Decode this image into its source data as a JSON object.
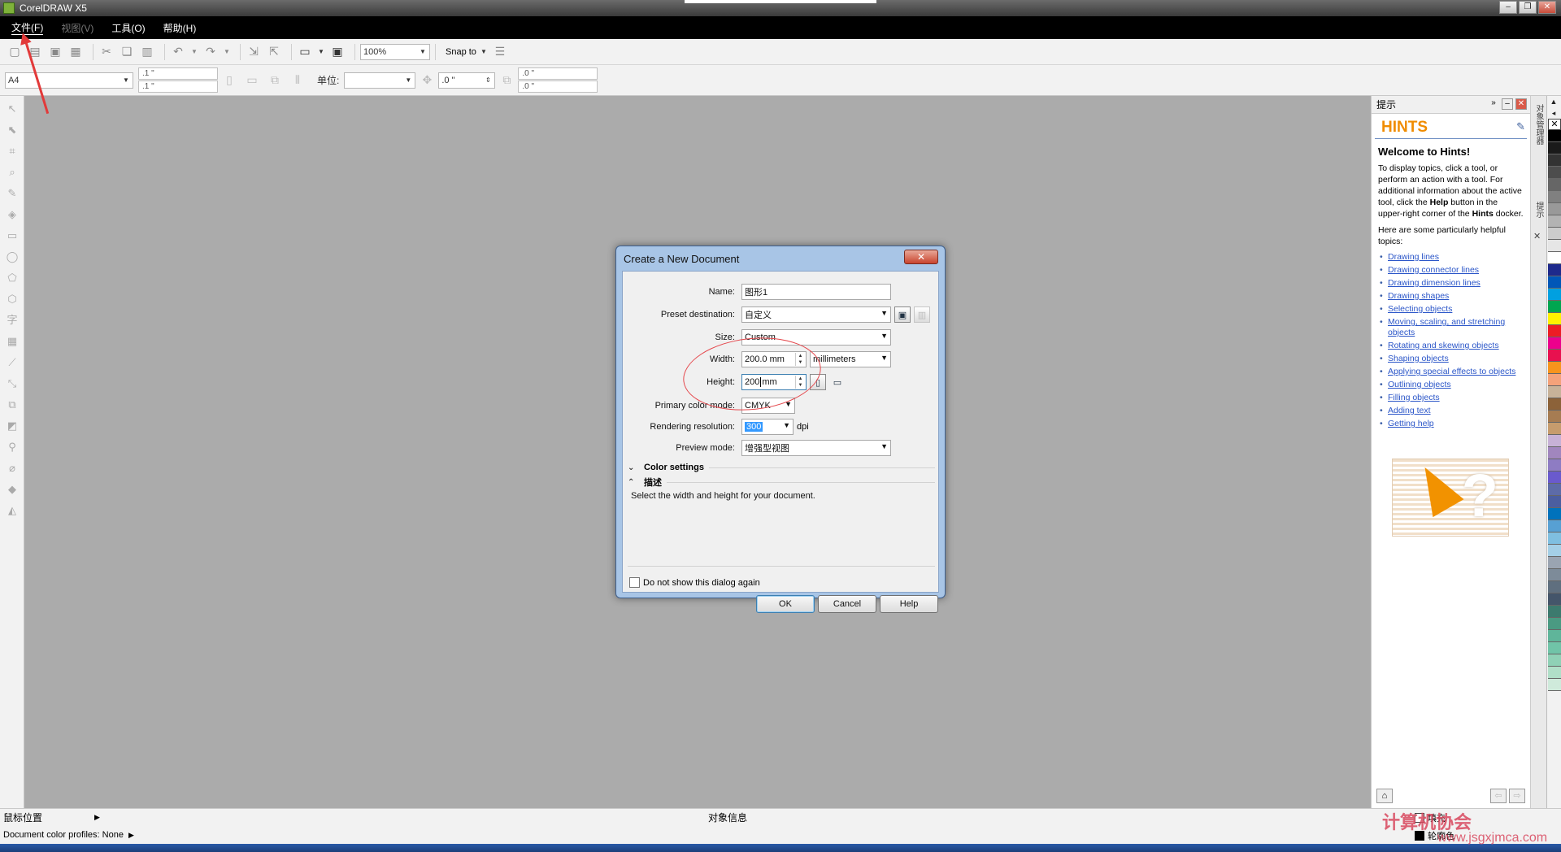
{
  "window": {
    "title": "CorelDRAW X5"
  },
  "menu": [
    {
      "label": "文件(F)",
      "state": "active"
    },
    {
      "label": "视图(V)",
      "state": "disabled"
    },
    {
      "label": "工具(O)",
      "state": "normal"
    },
    {
      "label": "帮助(H)",
      "state": "normal"
    }
  ],
  "toolbar": {
    "zoom": "100%",
    "snap_to": "Snap to"
  },
  "property_bar": {
    "page_size": "A4",
    "width_value": ".1 \"",
    "height_value": ".1 \"",
    "unit_label": "单位:",
    "nudge_value": ".0 \"",
    "dup_x": ".0 \"",
    "dup_y": ".0 \""
  },
  "dialog": {
    "title": "Create a New Document",
    "labels": {
      "name": "Name:",
      "preset": "Preset destination:",
      "size": "Size:",
      "width": "Width:",
      "height": "Height:",
      "color_mode": "Primary color mode:",
      "resolution": "Rendering resolution:",
      "preview": "Preview mode:"
    },
    "values": {
      "name": "图形1",
      "preset": "自定义",
      "size": "Custom",
      "width": "200.0 mm",
      "units": "millimeters",
      "height": "200",
      "height_unit": "mm",
      "color_mode": "CMYK",
      "resolution": "300",
      "resolution_unit": "dpi",
      "preview": "增强型视图"
    },
    "color_settings": "Color settings",
    "description_heading": "描述",
    "description_text": "Select the width and height for your document.",
    "dont_show": "Do not show this dialog again",
    "buttons": {
      "ok": "OK",
      "cancel": "Cancel",
      "help": "Help"
    }
  },
  "hints": {
    "docker_title": "提示",
    "title": "HINTS",
    "welcome": "Welcome to Hints!",
    "para1_a": "To display topics, click a tool, or perform an action with a tool. For additional information about the active tool, click the ",
    "para1_help": "Help",
    "para1_b": " button in the upper-right corner of the ",
    "para1_hints": "Hints",
    "para1_c": " docker.",
    "para2": "Here are some particularly helpful topics:",
    "links": [
      "Drawing lines",
      "Drawing connector lines",
      "Drawing dimension lines",
      "Drawing shapes",
      "Selecting objects",
      "Moving, scaling, and stretching objects",
      "Rotating and skewing objects",
      "Shaping objects",
      "Applying special effects to objects",
      "Outlining objects",
      "Filling objects",
      "Adding text",
      "Getting help"
    ]
  },
  "docker_tabs": [
    "对象管理器",
    "提示"
  ],
  "status": {
    "cursor_position": "鼠标位置",
    "object_info": "对象信息",
    "color_profiles": "Document color profiles: None",
    "fill": "填充",
    "outline": "轮廓色"
  },
  "watermark": {
    "main": "计算机协会",
    "url": "www.jsgxjmca.com"
  },
  "colors": {
    "accent_orange": "#f08c00",
    "link_blue": "#2a55c8",
    "annotation_red": "#e23a3a",
    "palette": [
      "#000000",
      "#1a1a1a",
      "#333333",
      "#4d4d4d",
      "#666666",
      "#808080",
      "#999999",
      "#b3b3b3",
      "#cccccc",
      "#e6e6e6",
      "#ffffff",
      "#1e2a8c",
      "#0057b8",
      "#00a0e0",
      "#00a650",
      "#fff200",
      "#ed1c24",
      "#ec008c",
      "#e8114f",
      "#f7941d",
      "#f4a27a",
      "#c7b299",
      "#8c6239",
      "#a67c52",
      "#c69c6d",
      "#c7b1d6",
      "#a186be",
      "#8e7cc3",
      "#6a5acd",
      "#5d6ba8",
      "#4b5ea0",
      "#0072bc",
      "#57a0d3",
      "#7fbfe0",
      "#a4cfe6",
      "#9aa4b1",
      "#7d8b99",
      "#5f6f7f",
      "#44556a",
      "#3c7a6e",
      "#4a9a82",
      "#5fb59a",
      "#70c4a8",
      "#8fd1b6",
      "#b0dfc8",
      "#cfeadb"
    ]
  }
}
